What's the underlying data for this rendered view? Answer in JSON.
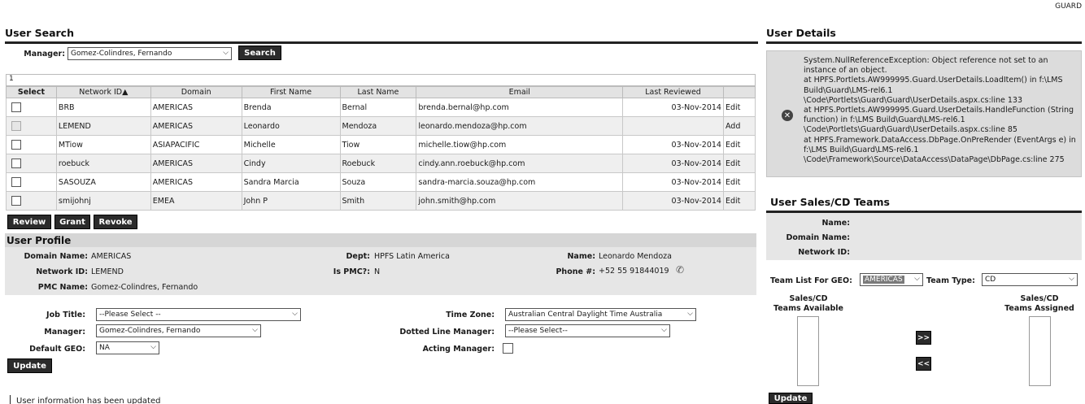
{
  "top_right": "GUARD",
  "user_search": {
    "title": "User Search",
    "manager_label": "Manager:",
    "manager_value": "Gomez-Colindres, Fernando",
    "search_button": "Search",
    "pager": "1",
    "columns": [
      "Select",
      "Network ID▲",
      "Domain",
      "First Name",
      "Last Name",
      "Email",
      "Last Reviewed",
      ""
    ],
    "rows": [
      {
        "network_id": "BRB",
        "domain": "AMERICAS",
        "first": "Brenda",
        "last": "Bernal",
        "email": "brenda.bernal@hp.com",
        "reviewed": "03-Nov-2014",
        "action": "Edit"
      },
      {
        "network_id": "LEMEND",
        "domain": "AMERICAS",
        "first": "Leonardo",
        "last": "Mendoza",
        "email": "leonardo.mendoza@hp.com",
        "reviewed": "",
        "action": "Add"
      },
      {
        "network_id": "MTiow",
        "domain": "ASIAPACIFIC",
        "first": "Michelle",
        "last": "Tiow",
        "email": "michelle.tiow@hp.com",
        "reviewed": "03-Nov-2014",
        "action": "Edit"
      },
      {
        "network_id": "roebuck",
        "domain": "AMERICAS",
        "first": "Cindy",
        "last": "Roebuck",
        "email": "cindy.ann.roebuck@hp.com",
        "reviewed": "03-Nov-2014",
        "action": "Edit"
      },
      {
        "network_id": "SASOUZA",
        "domain": "AMERICAS",
        "first": "Sandra Marcia",
        "last": "Souza",
        "email": "sandra-marcia.souza@hp.com",
        "reviewed": "03-Nov-2014",
        "action": "Edit"
      },
      {
        "network_id": "smijohnj",
        "domain": "EMEA",
        "first": "John P",
        "last": "Smith",
        "email": "john.smith@hp.com",
        "reviewed": "03-Nov-2014",
        "action": "Edit"
      }
    ],
    "review_button": "Review",
    "grant_button": "Grant",
    "revoke_button": "Revoke"
  },
  "user_profile": {
    "title": "User Profile",
    "domain_label": "Domain Name:",
    "domain_value": "AMERICAS",
    "dept_label": "Dept:",
    "dept_value": "HPFS Latin America",
    "name_label": "Name:",
    "name_value": "Leonardo Mendoza",
    "network_label": "Network ID:",
    "network_value": "LEMEND",
    "pmc_label": "Is PMC?:",
    "pmc_value": "N",
    "phone_label": "Phone #:",
    "phone_value": "+52 55 91844019",
    "pmc_name_label": "PMC Name:",
    "pmc_name_value": "Gomez-Colindres, Fernando",
    "job_title_label": "Job Title:",
    "job_title_value": "--Please Select --",
    "manager_label": "Manager:",
    "manager_value": "Gomez-Colindres, Fernando",
    "default_geo_label": "Default GEO:",
    "default_geo_value": "NA",
    "time_zone_label": "Time Zone:",
    "time_zone_value": "Australian Central Daylight Time Australia",
    "dotted_label": "Dotted Line Manager:",
    "dotted_value": "--Please Select--",
    "acting_label": "Acting Manager:",
    "update_button": "Update",
    "status_message": "User information has been updated"
  },
  "user_details": {
    "title": "User Details",
    "error_text": "System.NullReferenceException: Object reference not set to an instance of an object.\nat HPFS.Portlets.AW999995.Guard.UserDetails.LoadItem() in f:\\LMS Build\\Guard\\LMS-rel6.1\n\\Code\\Portlets\\Guard\\Guard\\UserDetails.aspx.cs:line 133\nat HPFS.Portlets.AW999995.Guard.UserDetails.HandleFunction (String function) in f:\\LMS Build\\Guard\\LMS-rel6.1\n\\Code\\Portlets\\Guard\\Guard\\UserDetails.aspx.cs:line 85\nat HPFS.Framework.DataAccess.DbPage.OnPreRender (EventArgs e) in f:\\LMS Build\\Guard\\LMS-rel6.1\n\\Code\\Framework\\Source\\DataAccess\\DataPage\\DbPage.cs:line 275"
  },
  "sales_teams": {
    "title": "User Sales/CD Teams",
    "name_label": "Name:",
    "domain_label": "Domain Name:",
    "network_label": "Network ID:",
    "geo_label": "Team List For GEO:",
    "geo_value": "AMERICAS",
    "type_label": "Team Type:",
    "type_value": "CD",
    "available_label": "Sales/CD\nTeams Available",
    "assigned_label": "Sales/CD\nTeams Assigned",
    "add_button": ">>",
    "remove_button": "<<",
    "update_button": "Update"
  }
}
